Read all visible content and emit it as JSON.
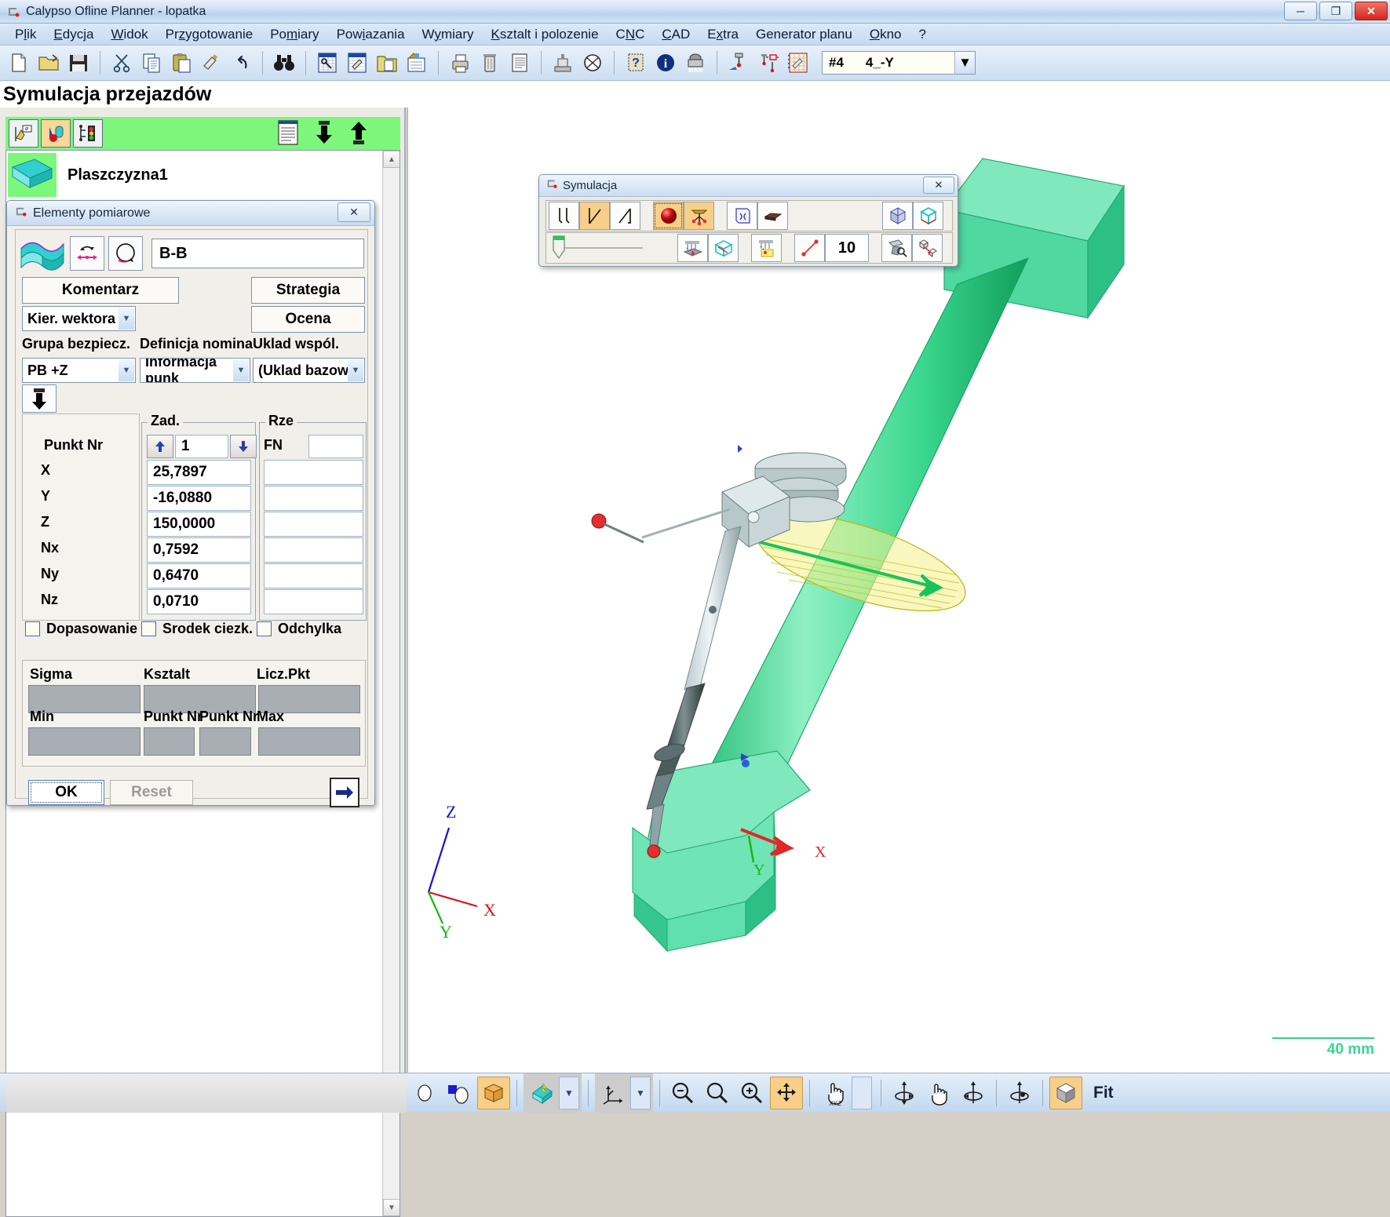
{
  "window": {
    "title": "Calypso Ofline Planner - lopatka",
    "icon": "app-icon",
    "controls": {
      "minimize": "─",
      "maximize": "❐",
      "close": "✕"
    }
  },
  "menubar": {
    "items": [
      {
        "label": "Plik",
        "mnemonic": "l"
      },
      {
        "label": "Edycja",
        "mnemonic": "E"
      },
      {
        "label": "Widok",
        "mnemonic": "W"
      },
      {
        "label": "Przygotowanie",
        "mnemonic": "z"
      },
      {
        "label": "Pomiary",
        "mnemonic": "m"
      },
      {
        "label": "Powiazania",
        "mnemonic": "i"
      },
      {
        "label": "Wymiary",
        "mnemonic": "y"
      },
      {
        "label": "Ksztalt i polozenie",
        "mnemonic": "K"
      },
      {
        "label": "CNC",
        "mnemonic": "N"
      },
      {
        "label": "CAD",
        "mnemonic": "A"
      },
      {
        "label": "Extra",
        "mnemonic": "x"
      },
      {
        "label": "Generator planu",
        "mnemonic": ""
      },
      {
        "label": "Okno",
        "mnemonic": "O"
      },
      {
        "label": "?",
        "mnemonic": ""
      }
    ]
  },
  "toolbar": {
    "buttons": [
      {
        "name": "new-document-icon"
      },
      {
        "name": "open-folder-icon"
      },
      {
        "name": "save-disk-icon"
      },
      {
        "sep": true
      },
      {
        "name": "cut-scissors-icon"
      },
      {
        "name": "copy-icon"
      },
      {
        "name": "paste-icon"
      },
      {
        "name": "format-painter-icon"
      },
      {
        "name": "undo-icon"
      },
      {
        "sep": true
      },
      {
        "name": "binoculars-search-icon"
      },
      {
        "name": "measurement-plan-icon"
      },
      {
        "name": "edit-plan-icon"
      },
      {
        "name": "open-plan-folder-icon"
      },
      {
        "name": "plan-stack-icon"
      },
      {
        "sep": true
      },
      {
        "name": "print-icon"
      },
      {
        "name": "delete-trash-icon"
      },
      {
        "name": "report-icon"
      },
      {
        "sep": true
      },
      {
        "name": "cmm-machine-icon"
      },
      {
        "name": "probe-sphere-icon"
      },
      {
        "sep": true
      },
      {
        "name": "help-question-icon"
      },
      {
        "name": "info-icon"
      },
      {
        "name": "manual-mode-icon"
      },
      {
        "sep": true
      },
      {
        "name": "probe-change-icon"
      },
      {
        "name": "stylus-calibration-icon"
      },
      {
        "name": "feature-matrix-icon"
      }
    ],
    "stylus_combo": {
      "id": "#4",
      "label": "4_-Y",
      "arrow": "▼"
    }
  },
  "page": {
    "title": "Symulacja przejazdów"
  },
  "left_panel": {
    "green_bar": {
      "buttons": [
        {
          "name": "feature-properties-icon",
          "selected": false
        },
        {
          "name": "probe-colors-icon",
          "selected": true
        },
        {
          "name": "traffic-light-icon",
          "selected": false
        }
      ],
      "right_buttons": [
        {
          "name": "list-report-icon"
        },
        {
          "name": "move-down-icon"
        },
        {
          "name": "move-up-icon"
        }
      ]
    },
    "tree": {
      "items": [
        {
          "label": "Plaszczyzna1",
          "icon": "plane-feature-icon"
        },
        {
          "label": "",
          "icon": "plane-feature-icon"
        }
      ],
      "scroll_up": "▲",
      "scroll_down": "▼"
    }
  },
  "dialog": {
    "title": "Elementy pomiarowe",
    "close": "✕",
    "feature_icon": "freeform-surface-icon",
    "direction_button": "bidirectional-arrow-icon",
    "circular_button": "circular-path-icon",
    "name_value": "B-B",
    "buttons": {
      "comment": "Komentarz",
      "strategy": "Strategia",
      "evaluation": "Ocena",
      "ok": "OK",
      "reset": "Reset",
      "next": "next-arrow-icon"
    },
    "combos": {
      "vector_direction": "Kier. wektora za",
      "safety_group_label": "Grupa bezpiecz.",
      "safety_group_value": "PB +Z",
      "nominal_definition_label": "Definicja nominaln",
      "nominal_definition_value": "Informacja punk",
      "coordinate_system_label": "Uklad wspól.",
      "coordinate_system_value": "(Uklad bazowy)",
      "arrow": "▼"
    },
    "import_button": "import-points-icon",
    "groups": {
      "nominal_legend": "Zad.",
      "actual_legend": "Rze"
    },
    "point_nav": {
      "up": "⬆",
      "down": "⬇",
      "value": "1"
    },
    "rows": [
      {
        "label": "Punkt Nr",
        "nominal": "1",
        "actual": "",
        "actual_label": "FN"
      },
      {
        "label": "X",
        "nominal": "25,7897",
        "actual": ""
      },
      {
        "label": "Y",
        "nominal": "-16,0880",
        "actual": ""
      },
      {
        "label": "Z",
        "nominal": "150,0000",
        "actual": ""
      },
      {
        "label": "Nx",
        "nominal": "0,7592",
        "actual": ""
      },
      {
        "label": "Ny",
        "nominal": "0,6470",
        "actual": ""
      },
      {
        "label": "Nz",
        "nominal": "0,0710",
        "actual": ""
      }
    ],
    "checkboxes": [
      {
        "label": "Dopasowanie",
        "checked": false
      },
      {
        "label": "Srodek ciezk.",
        "checked": false
      },
      {
        "label": "Odchylka",
        "checked": false
      }
    ],
    "stats": {
      "headers_row1": [
        "Sigma",
        "Ksztalt",
        "Licz.Pkt"
      ],
      "values_row1": [
        "",
        "",
        ""
      ],
      "headers_row2": [
        "Min",
        "Punkt Nr",
        "Punkt Nr",
        "Max"
      ],
      "values_row2": [
        "",
        "",
        "",
        ""
      ]
    }
  },
  "simulation_toolbox": {
    "title": "Symulacja",
    "close": "✕",
    "row1": [
      {
        "name": "step-parallel-icon",
        "state": "off"
      },
      {
        "name": "step-diagonal-icon",
        "state": "on"
      },
      {
        "name": "step-line-icon",
        "state": "off"
      },
      {
        "gap": true
      },
      {
        "name": "collision-sphere-icon",
        "state": "on-selected"
      },
      {
        "name": "stylus-tree-icon",
        "state": "on"
      },
      {
        "gap": true
      },
      {
        "name": "clearance-plane-icon",
        "state": "off"
      },
      {
        "name": "workpiece-block-icon",
        "state": "off"
      },
      {
        "gap_wide": true
      },
      {
        "name": "bounding-box-icon",
        "state": "off"
      },
      {
        "name": "wireframe-box-icon",
        "state": "off"
      }
    ],
    "row2": [
      {
        "name": "speed-slider",
        "state": "slider"
      },
      {
        "gap": true
      },
      {
        "name": "machine-view-icon",
        "state": "off"
      },
      {
        "name": "part-view-icon",
        "state": "off"
      },
      {
        "gap": true
      },
      {
        "name": "machine-part-view-icon",
        "state": "off"
      },
      {
        "gap": true
      },
      {
        "name": "travel-path-icon",
        "state": "off"
      },
      {
        "name": "travel-count",
        "state": "value",
        "value": "10"
      },
      {
        "gap": true
      },
      {
        "name": "probe-orientation-icon",
        "state": "off"
      },
      {
        "name": "collision-distance-icon",
        "state": "off"
      }
    ],
    "slider_value": "10"
  },
  "viewport": {
    "scale_label": "40 mm",
    "axes": [
      {
        "label": "Z",
        "color": "#1414d8"
      },
      {
        "label": "X",
        "color": "#d81414"
      },
      {
        "label": "Y",
        "color": "#14b814"
      }
    ],
    "part_axes": [
      {
        "label": "X",
        "color": "#d81414"
      },
      {
        "label": "Y",
        "color": "#14b814"
      }
    ]
  },
  "bottom_toolbar": {
    "items": [
      {
        "name": "shading-off-icon",
        "state": "off"
      },
      {
        "name": "shading-half-icon",
        "state": "off"
      },
      {
        "name": "shading-solid-icon",
        "state": "on"
      },
      {
        "sep": true
      },
      {
        "name": "surface-color-icon",
        "state": "off"
      },
      {
        "name": "surface-color-dropdown",
        "state": "dropdown",
        "arrow": "▼"
      },
      {
        "sep": true
      },
      {
        "name": "coordinate-axes-icon",
        "state": "off"
      },
      {
        "name": "coordinate-axes-dropdown",
        "state": "dropdown",
        "arrow": "▼"
      },
      {
        "sep": true
      },
      {
        "name": "zoom-out-icon",
        "state": "off"
      },
      {
        "name": "zoom-window-icon",
        "state": "off"
      },
      {
        "name": "zoom-in-icon",
        "state": "off"
      },
      {
        "name": "pan-move-icon",
        "state": "on"
      },
      {
        "sep": true
      },
      {
        "name": "hand-xyz-icon",
        "state": "off"
      },
      {
        "name": "hand-xyz-dropdown",
        "state": "dropdown",
        "arrow": "▼"
      },
      {
        "sep": true
      },
      {
        "name": "rotate-vertical-icon",
        "state": "off"
      },
      {
        "name": "rotate-hand-icon",
        "state": "off"
      },
      {
        "name": "rotate-axis-icon",
        "state": "off"
      },
      {
        "sep": true
      },
      {
        "name": "rotate-free-icon",
        "state": "off"
      },
      {
        "sep": true
      },
      {
        "name": "fit-cube-icon",
        "state": "on"
      }
    ],
    "fit_label": "Fit"
  }
}
